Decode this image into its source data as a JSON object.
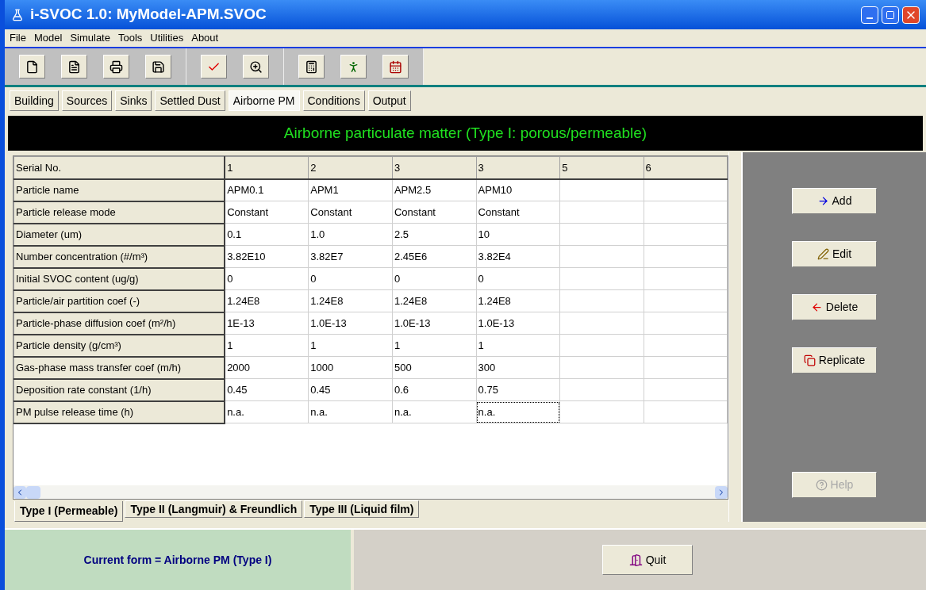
{
  "window": {
    "title": "i-SVOC 1.0:  MyModel-APM.SVOC"
  },
  "menu": [
    "File",
    "Model",
    "Simulate",
    "Tools",
    "Utilities",
    "About"
  ],
  "tabs": [
    {
      "label": "Building",
      "selected": false
    },
    {
      "label": "Sources",
      "selected": false
    },
    {
      "label": "Sinks",
      "selected": false
    },
    {
      "label": "Settled Dust",
      "selected": false
    },
    {
      "label": "Airborne PM",
      "selected": true
    },
    {
      "label": "Conditions",
      "selected": false
    },
    {
      "label": "Output",
      "selected": false
    }
  ],
  "form_title": "Airborne particulate matter (Type I: porous/permeable)",
  "table": {
    "header_label": "Serial No.",
    "columns": [
      "1",
      "2",
      "3",
      "3",
      "5",
      "6"
    ],
    "rows": [
      {
        "label": "Particle name",
        "cells": [
          {
            "text": "APM0.1",
            "focused": false
          },
          {
            "text": "APM1",
            "focused": false
          },
          {
            "text": "APM2.5",
            "focused": false
          },
          {
            "text": "APM10",
            "focused": false
          }
        ]
      },
      {
        "label": "Particle release mode",
        "cells": [
          {
            "text": "Constant",
            "focused": false
          },
          {
            "text": "Constant",
            "focused": false
          },
          {
            "text": "Constant",
            "focused": false
          },
          {
            "text": "Constant",
            "focused": false
          }
        ]
      },
      {
        "label": "Diameter (um)",
        "cells": [
          {
            "text": "0.1",
            "focused": false
          },
          {
            "text": "1.0",
            "focused": false
          },
          {
            "text": "2.5",
            "focused": false
          },
          {
            "text": "10",
            "focused": false
          }
        ]
      },
      {
        "label": "Number concentration (#/m³)",
        "cells": [
          {
            "text": "3.82E10",
            "focused": false
          },
          {
            "text": "3.82E7",
            "focused": false
          },
          {
            "text": "2.45E6",
            "focused": false
          },
          {
            "text": "3.82E4",
            "focused": false
          }
        ]
      },
      {
        "label": "Initial SVOC content (ug/g)",
        "cells": [
          {
            "text": "0",
            "focused": false
          },
          {
            "text": "0",
            "focused": false
          },
          {
            "text": "0",
            "focused": false
          },
          {
            "text": "0",
            "focused": false
          }
        ]
      },
      {
        "label": "Particle/air partition coef (-)",
        "cells": [
          {
            "text": "1.24E8",
            "focused": false
          },
          {
            "text": "1.24E8",
            "focused": false
          },
          {
            "text": "1.24E8",
            "focused": false
          },
          {
            "text": "1.24E8",
            "focused": false
          }
        ]
      },
      {
        "label": "Particle-phase diffusion coef (m²/h)",
        "cells": [
          {
            "text": "1E-13",
            "focused": false
          },
          {
            "text": "1.0E-13",
            "focused": false
          },
          {
            "text": "1.0E-13",
            "focused": false
          },
          {
            "text": "1.0E-13",
            "focused": false
          }
        ]
      },
      {
        "label": "Particle density (g/cm³)",
        "cells": [
          {
            "text": "1",
            "focused": false
          },
          {
            "text": "1",
            "focused": false
          },
          {
            "text": "1",
            "focused": false
          },
          {
            "text": "1",
            "focused": false
          }
        ]
      },
      {
        "label": "Gas-phase mass transfer coef (m/h)",
        "cells": [
          {
            "text": "2000",
            "focused": false
          },
          {
            "text": "1000",
            "focused": false
          },
          {
            "text": "500",
            "focused": false
          },
          {
            "text": "300",
            "focused": false
          }
        ]
      },
      {
        "label": "Deposition rate constant (1/h)",
        "cells": [
          {
            "text": "0.45",
            "focused": false
          },
          {
            "text": "0.45",
            "focused": false
          },
          {
            "text": "0.6",
            "focused": false
          },
          {
            "text": "0.75",
            "focused": false
          }
        ]
      },
      {
        "label": "PM pulse release time (h)",
        "cells": [
          {
            "text": "n.a.",
            "focused": false
          },
          {
            "text": "n.a.",
            "focused": false
          },
          {
            "text": "n.a.",
            "focused": false
          },
          {
            "text": "n.a.",
            "focused": true
          }
        ]
      }
    ]
  },
  "side_buttons": [
    {
      "label": "Add",
      "kind": "add",
      "disabled": false
    },
    {
      "label": "Edit",
      "kind": "edit",
      "disabled": false
    },
    {
      "label": "Delete",
      "kind": "delete",
      "disabled": false
    },
    {
      "label": "Replicate",
      "kind": "replicate",
      "disabled": false
    },
    {
      "label": "Help",
      "kind": "help",
      "disabled": true
    }
  ],
  "type_tabs": [
    {
      "label": "Type I (Permeable)",
      "selected": true
    },
    {
      "label": "Type II (Langmuir) & Freundlich",
      "selected": false
    },
    {
      "label": "Type III (Liquid film)",
      "selected": false
    }
  ],
  "status": "Current form = Airborne PM (Type I)",
  "quit_button": "Quit"
}
